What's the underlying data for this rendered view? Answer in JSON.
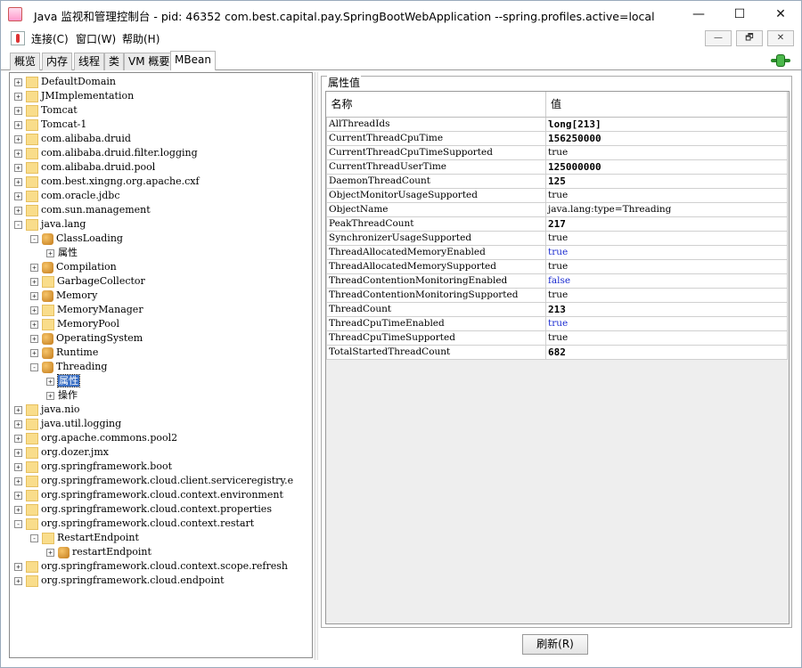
{
  "window": {
    "title": "Java 监视和管理控制台 - pid: 46352 com.best.capital.pay.SpringBootWebApplication --spring.profiles.active=local",
    "minimize": "—",
    "maximize": "☐",
    "close": "✕"
  },
  "menu": {
    "items": [
      "连接(C)",
      "窗口(W)",
      "帮助(H)"
    ],
    "mdi": [
      "—",
      "🗗",
      "✕"
    ]
  },
  "tabs": [
    "概览",
    "内存",
    "线程",
    "类",
    "VM 概要",
    "MBean"
  ],
  "active_tab": "MBean",
  "tree": [
    {
      "label": "DefaultDomain",
      "level": 0,
      "kind": "folder",
      "exp": "+"
    },
    {
      "label": "JMImplementation",
      "level": 0,
      "kind": "folder",
      "exp": "+"
    },
    {
      "label": "Tomcat",
      "level": 0,
      "kind": "folder",
      "exp": "+"
    },
    {
      "label": "Tomcat-1",
      "level": 0,
      "kind": "folder",
      "exp": "+"
    },
    {
      "label": "com.alibaba.druid",
      "level": 0,
      "kind": "folder",
      "exp": "+"
    },
    {
      "label": "com.alibaba.druid.filter.logging",
      "level": 0,
      "kind": "folder",
      "exp": "+"
    },
    {
      "label": "com.alibaba.druid.pool",
      "level": 0,
      "kind": "folder",
      "exp": "+"
    },
    {
      "label": "com.best.xingng.org.apache.cxf",
      "level": 0,
      "kind": "folder",
      "exp": "+"
    },
    {
      "label": "com.oracle.jdbc",
      "level": 0,
      "kind": "folder",
      "exp": "+"
    },
    {
      "label": "com.sun.management",
      "level": 0,
      "kind": "folder",
      "exp": "+"
    },
    {
      "label": "java.lang",
      "level": 0,
      "kind": "folder",
      "exp": "-"
    },
    {
      "label": "ClassLoading",
      "level": 1,
      "kind": "bean",
      "exp": "-"
    },
    {
      "label": "属性",
      "level": 2,
      "kind": "none",
      "exp": "+"
    },
    {
      "label": "Compilation",
      "level": 1,
      "kind": "bean",
      "exp": "+"
    },
    {
      "label": "GarbageCollector",
      "level": 1,
      "kind": "folder",
      "exp": "+"
    },
    {
      "label": "Memory",
      "level": 1,
      "kind": "bean",
      "exp": "+"
    },
    {
      "label": "MemoryManager",
      "level": 1,
      "kind": "folder",
      "exp": "+"
    },
    {
      "label": "MemoryPool",
      "level": 1,
      "kind": "folder",
      "exp": "+"
    },
    {
      "label": "OperatingSystem",
      "level": 1,
      "kind": "bean",
      "exp": "+"
    },
    {
      "label": "Runtime",
      "level": 1,
      "kind": "bean",
      "exp": "+"
    },
    {
      "label": "Threading",
      "level": 1,
      "kind": "bean",
      "exp": "-"
    },
    {
      "label": "属性",
      "level": 2,
      "kind": "none",
      "exp": "+",
      "selected": true
    },
    {
      "label": "操作",
      "level": 2,
      "kind": "none",
      "exp": "+"
    },
    {
      "label": "java.nio",
      "level": 0,
      "kind": "folder",
      "exp": "+"
    },
    {
      "label": "java.util.logging",
      "level": 0,
      "kind": "folder",
      "exp": "+"
    },
    {
      "label": "org.apache.commons.pool2",
      "level": 0,
      "kind": "folder",
      "exp": "+"
    },
    {
      "label": "org.dozer.jmx",
      "level": 0,
      "kind": "folder",
      "exp": "+"
    },
    {
      "label": "org.springframework.boot",
      "level": 0,
      "kind": "folder",
      "exp": "+"
    },
    {
      "label": "org.springframework.cloud.client.serviceregistry.e",
      "level": 0,
      "kind": "folder",
      "exp": "+"
    },
    {
      "label": "org.springframework.cloud.context.environment",
      "level": 0,
      "kind": "folder",
      "exp": "+"
    },
    {
      "label": "org.springframework.cloud.context.properties",
      "level": 0,
      "kind": "folder",
      "exp": "+"
    },
    {
      "label": "org.springframework.cloud.context.restart",
      "level": 0,
      "kind": "folder",
      "exp": "-"
    },
    {
      "label": "RestartEndpoint",
      "level": 1,
      "kind": "folder",
      "exp": "-"
    },
    {
      "label": "restartEndpoint",
      "level": 2,
      "kind": "bean",
      "exp": "+"
    },
    {
      "label": "org.springframework.cloud.context.scope.refresh",
      "level": 0,
      "kind": "folder",
      "exp": "+"
    },
    {
      "label": "org.springframework.cloud.endpoint",
      "level": 0,
      "kind": "folder",
      "exp": "+"
    }
  ],
  "attributes": {
    "group_title": "属性值",
    "col_name": "名称",
    "col_value": "值",
    "rows": [
      {
        "name": "AllThreadIds",
        "value": "long[213]",
        "style": "bold"
      },
      {
        "name": "CurrentThreadCpuTime",
        "value": "156250000",
        "style": "bold"
      },
      {
        "name": "CurrentThreadCpuTimeSupported",
        "value": "true",
        "style": "plain"
      },
      {
        "name": "CurrentThreadUserTime",
        "value": "125000000",
        "style": "bold"
      },
      {
        "name": "DaemonThreadCount",
        "value": "125",
        "style": "bold"
      },
      {
        "name": "ObjectMonitorUsageSupported",
        "value": "true",
        "style": "plain"
      },
      {
        "name": "ObjectName",
        "value": "java.lang:type=Threading",
        "style": "plain"
      },
      {
        "name": "PeakThreadCount",
        "value": "217",
        "style": "bold"
      },
      {
        "name": "SynchronizerUsageSupported",
        "value": "true",
        "style": "plain"
      },
      {
        "name": "ThreadAllocatedMemoryEnabled",
        "value": "true",
        "style": "blue"
      },
      {
        "name": "ThreadAllocatedMemorySupported",
        "value": "true",
        "style": "plain"
      },
      {
        "name": "ThreadContentionMonitoringEnabled",
        "value": "false",
        "style": "blue"
      },
      {
        "name": "ThreadContentionMonitoringSupported",
        "value": "true",
        "style": "plain"
      },
      {
        "name": "ThreadCount",
        "value": "213",
        "style": "bold"
      },
      {
        "name": "ThreadCpuTimeEnabled",
        "value": "true",
        "style": "blue"
      },
      {
        "name": "ThreadCpuTimeSupported",
        "value": "true",
        "style": "plain"
      },
      {
        "name": "TotalStartedThreadCount",
        "value": "682",
        "style": "bold"
      }
    ]
  },
  "refresh_label": "刷新(R)"
}
